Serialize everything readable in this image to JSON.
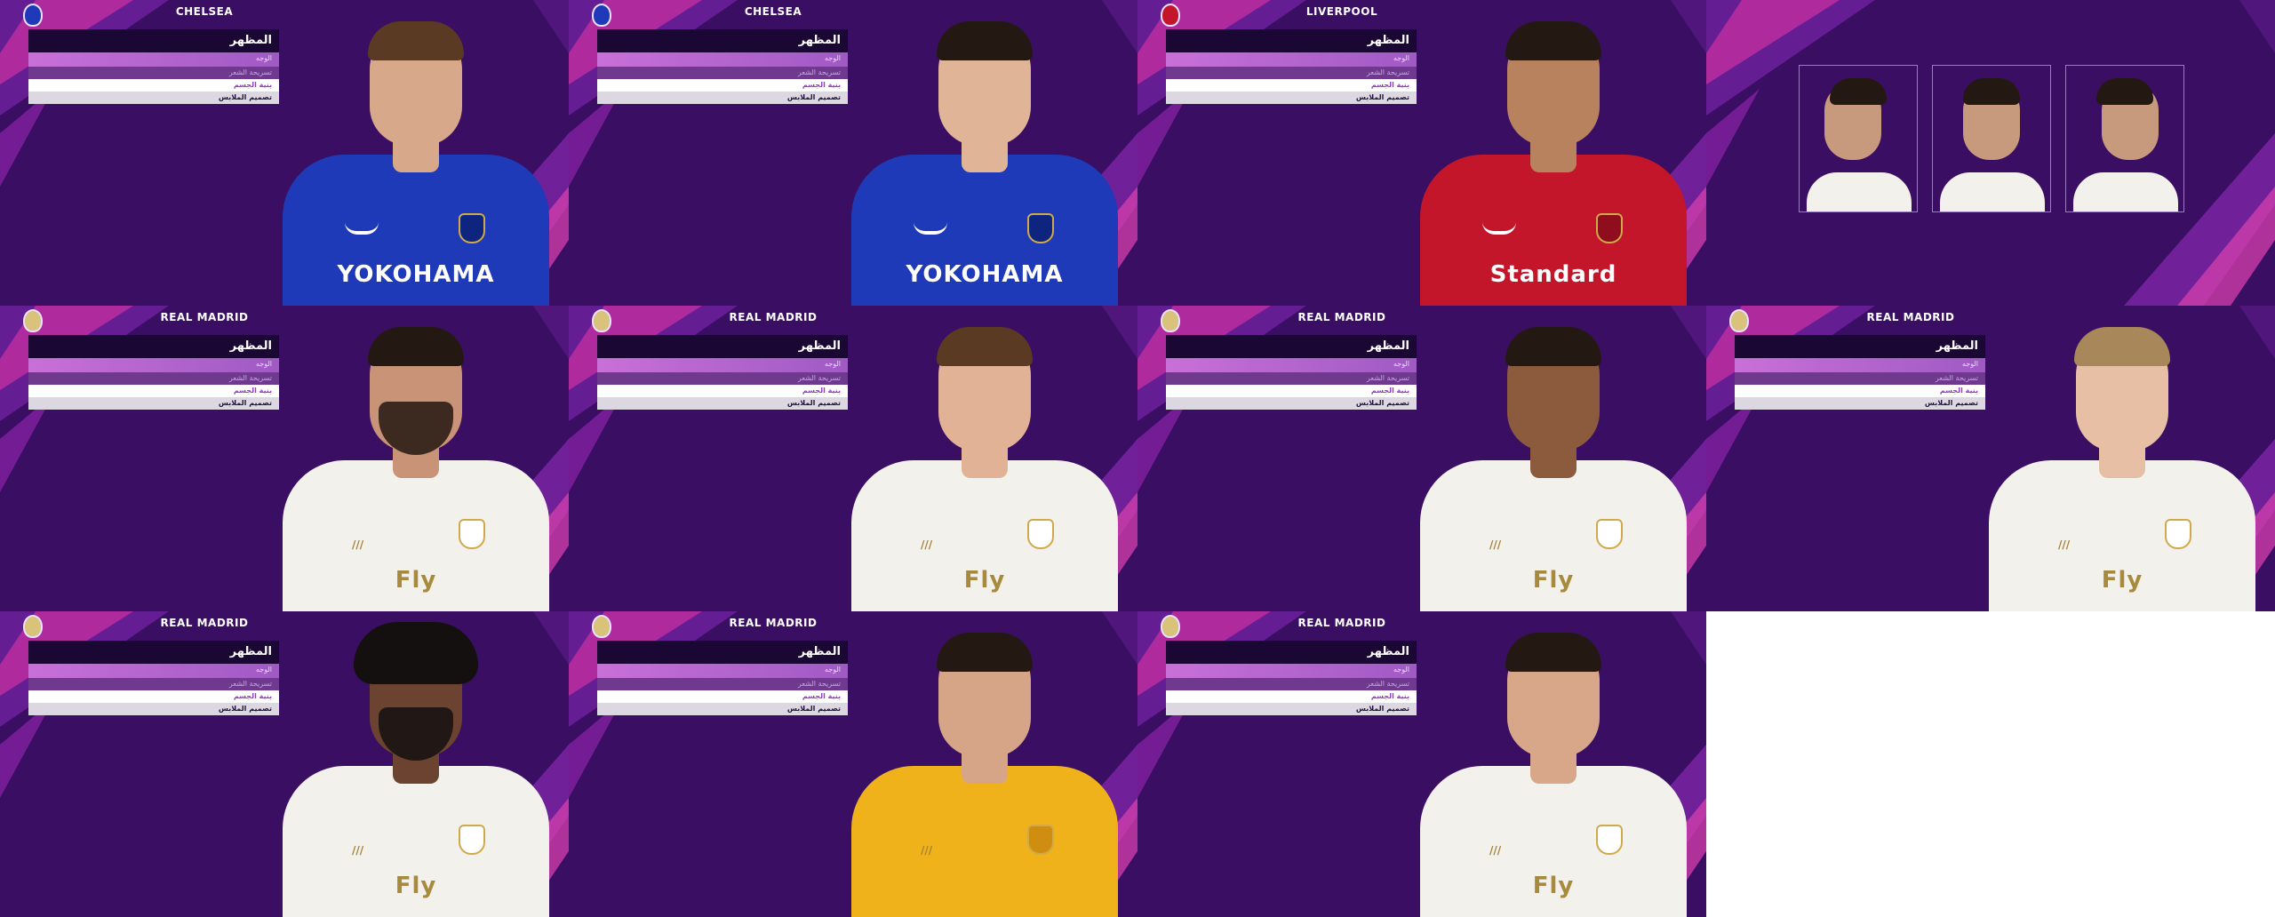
{
  "menu": {
    "header": "المظهر",
    "items": [
      "الوجه",
      "تسريحة الشعر",
      "بنية الجسم",
      "تصميم الملابس"
    ]
  },
  "panels": [
    {
      "club": "CHELSEA",
      "kit": "blue",
      "sponsor": "YOKOHAMA",
      "hair": "brown",
      "skin": "#d8a88a",
      "beard": false
    },
    {
      "club": "CHELSEA",
      "kit": "blue",
      "sponsor": "YOKOHAMA",
      "hair": "dark",
      "skin": "#e0b497",
      "beard": false
    },
    {
      "club": "LIVERPOOL",
      "kit": "red",
      "sponsor": "Standard",
      "hair": "dark",
      "skin": "#b9825e",
      "beard": false
    },
    {
      "club": "",
      "kit": "reference",
      "sponsor": "",
      "hair": "dark",
      "skin": "#c79a7e",
      "beard": false
    },
    {
      "club": "REAL MADRID",
      "kit": "white",
      "sponsor": "Fly",
      "hair": "dark",
      "skin": "#c99377",
      "beard": true
    },
    {
      "club": "REAL MADRID",
      "kit": "white",
      "sponsor": "Fly",
      "hair": "brown",
      "skin": "#e2b296",
      "beard": false
    },
    {
      "club": "REAL MADRID",
      "kit": "white",
      "sponsor": "Fly",
      "hair": "dark",
      "skin": "#8c5a3c",
      "beard": false
    },
    {
      "club": "REAL MADRID",
      "kit": "white",
      "sponsor": "Fly",
      "hair": "blond",
      "skin": "#e7bfa4",
      "beard": false
    },
    {
      "club": "REAL MADRID",
      "kit": "white",
      "sponsor": "Fly",
      "hair": "afro",
      "skin": "#6b4330",
      "beard": true
    },
    {
      "club": "REAL MADRID",
      "kit": "yellow",
      "sponsor": "",
      "hair": "dark",
      "skin": "#d6a588",
      "beard": false
    },
    {
      "club": "REAL MADRID",
      "kit": "white",
      "sponsor": "Fly",
      "hair": "dark",
      "skin": "#d8a78a",
      "beard": false
    }
  ],
  "colors": {
    "background": "#3a0e62",
    "accent_magenta": "#e040c0",
    "menu_header": "#1a0733",
    "selected_text": "#9b34d4"
  }
}
